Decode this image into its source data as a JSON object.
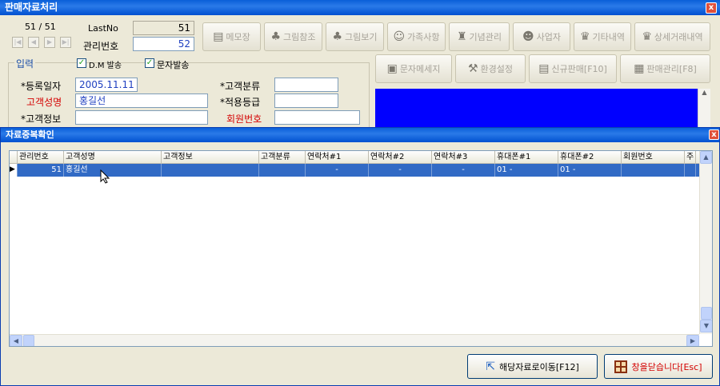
{
  "window": {
    "title": "판매자료처리",
    "close_label": "x"
  },
  "nav": {
    "counter": "51 / 51",
    "buttons": [
      "|◀",
      "◀",
      "▶",
      "▶|"
    ]
  },
  "record": {
    "lastno_label": "LastNo",
    "lastno_value": "51",
    "mgmt_label": "관리번호",
    "mgmt_value": "52"
  },
  "input_section": {
    "label": "입력",
    "dm_label": "D.M 발송",
    "dm_checked": true,
    "sms_label": "문자발송",
    "sms_checked": true
  },
  "form": {
    "reg_date_label": "*등록일자",
    "reg_date_value": "2005.11.11",
    "name_label": "고객성명",
    "name_value": "홍길선",
    "info_label": "*고객정보",
    "info_value": "",
    "class_label": "*고객분류",
    "class_value": "",
    "grade_label": "*적용등급",
    "grade_value": "",
    "member_label": "회원번호",
    "member_value": ""
  },
  "toolbar_row1": [
    {
      "label": "메모장",
      "icon": "notepad-icon",
      "glyph": "▤"
    },
    {
      "label": "그림참조",
      "icon": "tree-icon",
      "glyph": "♣"
    },
    {
      "label": "그림보기",
      "icon": "tree-icon",
      "glyph": "♣"
    },
    {
      "label": "가족사항",
      "icon": "family-icon",
      "glyph": "☺"
    },
    {
      "label": "기념관리",
      "icon": "bottle-icon",
      "glyph": "♜"
    },
    {
      "label": "사업자",
      "icon": "person-icon",
      "glyph": "☻"
    },
    {
      "label": "기타내역",
      "icon": "bag-icon",
      "glyph": "♛"
    },
    {
      "label": "상세거래내역",
      "icon": "bag-icon",
      "glyph": "♛"
    }
  ],
  "toolbar_row2": [
    {
      "label": "문자메세지",
      "icon": "message-icon",
      "glyph": "▣"
    },
    {
      "label": "환경설정",
      "icon": "settings-icon",
      "glyph": "⚒"
    },
    {
      "label": "신규판매[F10]",
      "icon": "new-sale-icon",
      "glyph": "▤"
    },
    {
      "label": "판매관리[F8]",
      "icon": "sales-mgmt-icon",
      "glyph": "▦"
    }
  ],
  "dialog": {
    "title": "자료중복확인",
    "columns": [
      "관리번호",
      "고객성명",
      "고객정보",
      "고객분류",
      "연락처#1",
      "연락처#2",
      "연락처#3",
      "휴대폰#1",
      "휴대폰#2",
      "회원번호",
      "주"
    ],
    "rows": [
      {
        "cells": [
          "51",
          "홍길선",
          "",
          "",
          "-",
          "-",
          "-",
          "01 -",
          "01 -",
          "",
          ""
        ]
      }
    ],
    "goto_button": "해당자료로이동[F12]",
    "close_button": "창을닫습니다[Esc]"
  },
  "colors": {
    "titlebar": "#0a5fd8",
    "selection": "#316ac5",
    "info_panel": "#0000ff",
    "required_label": "#d40000"
  }
}
